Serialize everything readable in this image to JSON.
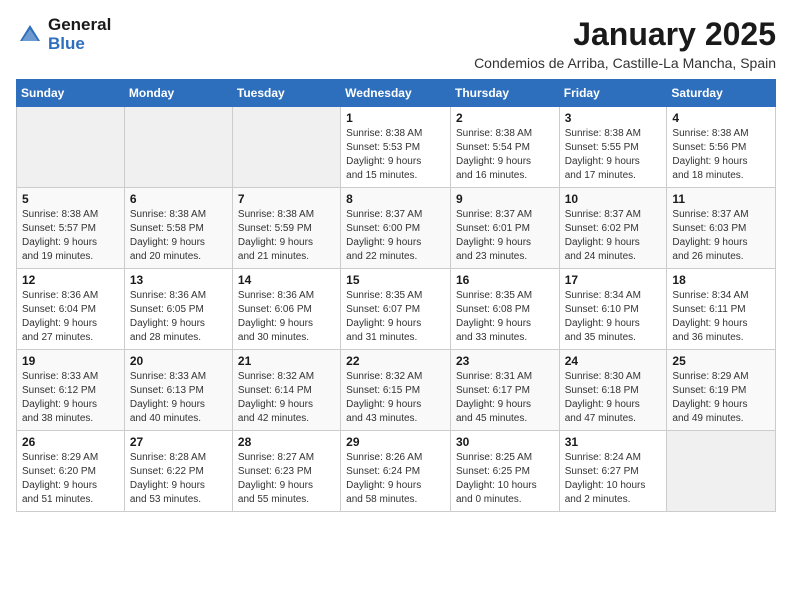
{
  "header": {
    "logo_general": "General",
    "logo_blue": "Blue",
    "month_title": "January 2025",
    "location": "Condemios de Arriba, Castille-La Mancha, Spain"
  },
  "weekdays": [
    "Sunday",
    "Monday",
    "Tuesday",
    "Wednesday",
    "Thursday",
    "Friday",
    "Saturday"
  ],
  "weeks": [
    [
      {
        "day": "",
        "content": ""
      },
      {
        "day": "",
        "content": ""
      },
      {
        "day": "",
        "content": ""
      },
      {
        "day": "1",
        "content": "Sunrise: 8:38 AM\nSunset: 5:53 PM\nDaylight: 9 hours\nand 15 minutes."
      },
      {
        "day": "2",
        "content": "Sunrise: 8:38 AM\nSunset: 5:54 PM\nDaylight: 9 hours\nand 16 minutes."
      },
      {
        "day": "3",
        "content": "Sunrise: 8:38 AM\nSunset: 5:55 PM\nDaylight: 9 hours\nand 17 minutes."
      },
      {
        "day": "4",
        "content": "Sunrise: 8:38 AM\nSunset: 5:56 PM\nDaylight: 9 hours\nand 18 minutes."
      }
    ],
    [
      {
        "day": "5",
        "content": "Sunrise: 8:38 AM\nSunset: 5:57 PM\nDaylight: 9 hours\nand 19 minutes."
      },
      {
        "day": "6",
        "content": "Sunrise: 8:38 AM\nSunset: 5:58 PM\nDaylight: 9 hours\nand 20 minutes."
      },
      {
        "day": "7",
        "content": "Sunrise: 8:38 AM\nSunset: 5:59 PM\nDaylight: 9 hours\nand 21 minutes."
      },
      {
        "day": "8",
        "content": "Sunrise: 8:37 AM\nSunset: 6:00 PM\nDaylight: 9 hours\nand 22 minutes."
      },
      {
        "day": "9",
        "content": "Sunrise: 8:37 AM\nSunset: 6:01 PM\nDaylight: 9 hours\nand 23 minutes."
      },
      {
        "day": "10",
        "content": "Sunrise: 8:37 AM\nSunset: 6:02 PM\nDaylight: 9 hours\nand 24 minutes."
      },
      {
        "day": "11",
        "content": "Sunrise: 8:37 AM\nSunset: 6:03 PM\nDaylight: 9 hours\nand 26 minutes."
      }
    ],
    [
      {
        "day": "12",
        "content": "Sunrise: 8:36 AM\nSunset: 6:04 PM\nDaylight: 9 hours\nand 27 minutes."
      },
      {
        "day": "13",
        "content": "Sunrise: 8:36 AM\nSunset: 6:05 PM\nDaylight: 9 hours\nand 28 minutes."
      },
      {
        "day": "14",
        "content": "Sunrise: 8:36 AM\nSunset: 6:06 PM\nDaylight: 9 hours\nand 30 minutes."
      },
      {
        "day": "15",
        "content": "Sunrise: 8:35 AM\nSunset: 6:07 PM\nDaylight: 9 hours\nand 31 minutes."
      },
      {
        "day": "16",
        "content": "Sunrise: 8:35 AM\nSunset: 6:08 PM\nDaylight: 9 hours\nand 33 minutes."
      },
      {
        "day": "17",
        "content": "Sunrise: 8:34 AM\nSunset: 6:10 PM\nDaylight: 9 hours\nand 35 minutes."
      },
      {
        "day": "18",
        "content": "Sunrise: 8:34 AM\nSunset: 6:11 PM\nDaylight: 9 hours\nand 36 minutes."
      }
    ],
    [
      {
        "day": "19",
        "content": "Sunrise: 8:33 AM\nSunset: 6:12 PM\nDaylight: 9 hours\nand 38 minutes."
      },
      {
        "day": "20",
        "content": "Sunrise: 8:33 AM\nSunset: 6:13 PM\nDaylight: 9 hours\nand 40 minutes."
      },
      {
        "day": "21",
        "content": "Sunrise: 8:32 AM\nSunset: 6:14 PM\nDaylight: 9 hours\nand 42 minutes."
      },
      {
        "day": "22",
        "content": "Sunrise: 8:32 AM\nSunset: 6:15 PM\nDaylight: 9 hours\nand 43 minutes."
      },
      {
        "day": "23",
        "content": "Sunrise: 8:31 AM\nSunset: 6:17 PM\nDaylight: 9 hours\nand 45 minutes."
      },
      {
        "day": "24",
        "content": "Sunrise: 8:30 AM\nSunset: 6:18 PM\nDaylight: 9 hours\nand 47 minutes."
      },
      {
        "day": "25",
        "content": "Sunrise: 8:29 AM\nSunset: 6:19 PM\nDaylight: 9 hours\nand 49 minutes."
      }
    ],
    [
      {
        "day": "26",
        "content": "Sunrise: 8:29 AM\nSunset: 6:20 PM\nDaylight: 9 hours\nand 51 minutes."
      },
      {
        "day": "27",
        "content": "Sunrise: 8:28 AM\nSunset: 6:22 PM\nDaylight: 9 hours\nand 53 minutes."
      },
      {
        "day": "28",
        "content": "Sunrise: 8:27 AM\nSunset: 6:23 PM\nDaylight: 9 hours\nand 55 minutes."
      },
      {
        "day": "29",
        "content": "Sunrise: 8:26 AM\nSunset: 6:24 PM\nDaylight: 9 hours\nand 58 minutes."
      },
      {
        "day": "30",
        "content": "Sunrise: 8:25 AM\nSunset: 6:25 PM\nDaylight: 10 hours\nand 0 minutes."
      },
      {
        "day": "31",
        "content": "Sunrise: 8:24 AM\nSunset: 6:27 PM\nDaylight: 10 hours\nand 2 minutes."
      },
      {
        "day": "",
        "content": ""
      }
    ]
  ]
}
